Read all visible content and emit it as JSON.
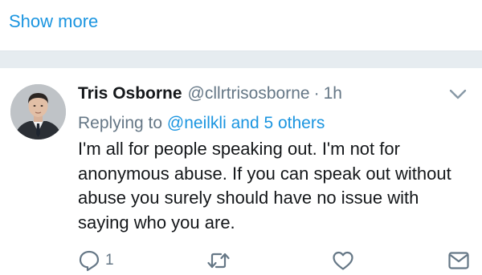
{
  "show_more": {
    "label": "Show more"
  },
  "tweet": {
    "author_name": "Tris Osborne",
    "author_handle": "@cllrtrisosborne",
    "separator": "·",
    "timestamp": "1h",
    "replying_prefix": "Replying to",
    "replying_mentions": "@neilkli and 5 others",
    "text": "I'm all for people speaking out. I'm not for anonymous abuse. If you can speak out without abuse you surely should have no issue with saying who you are.",
    "reply_count": "1"
  },
  "icons": {
    "caret": "chevron-down-icon",
    "reply": "reply-icon",
    "retweet": "retweet-icon",
    "like": "heart-icon",
    "dm": "envelope-icon"
  },
  "colors": {
    "link": "#1b95e0",
    "secondary_text": "#657786",
    "primary_text": "#14171a",
    "separator_bg": "#e6ecf0"
  }
}
